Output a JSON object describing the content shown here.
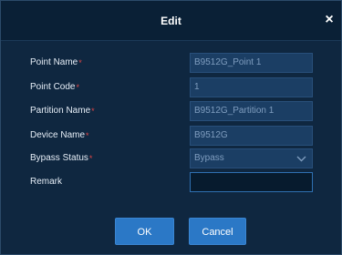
{
  "dialog": {
    "title": "Edit",
    "close_glyph": "×"
  },
  "fields": [
    {
      "label": "Point Name",
      "required": true,
      "value": "B9512G_Point 1"
    },
    {
      "label": "Point Code",
      "required": true,
      "value": "1"
    },
    {
      "label": "Partition Name",
      "required": true,
      "value": "B9512G_Partition 1"
    },
    {
      "label": "Device Name",
      "required": true,
      "value": "B9512G"
    },
    {
      "label": "Bypass Status",
      "required": true,
      "value": "Bypass"
    },
    {
      "label": "Remark",
      "required": false,
      "value": ""
    }
  ],
  "required_marker": "*",
  "select_icon": "chevron-down-icon",
  "buttons": {
    "ok": "OK",
    "cancel": "Cancel"
  },
  "colors": {
    "background": "#0f2740",
    "input_bg": "#1b3e64",
    "accent": "#2b78c6",
    "required": "#e04646"
  }
}
